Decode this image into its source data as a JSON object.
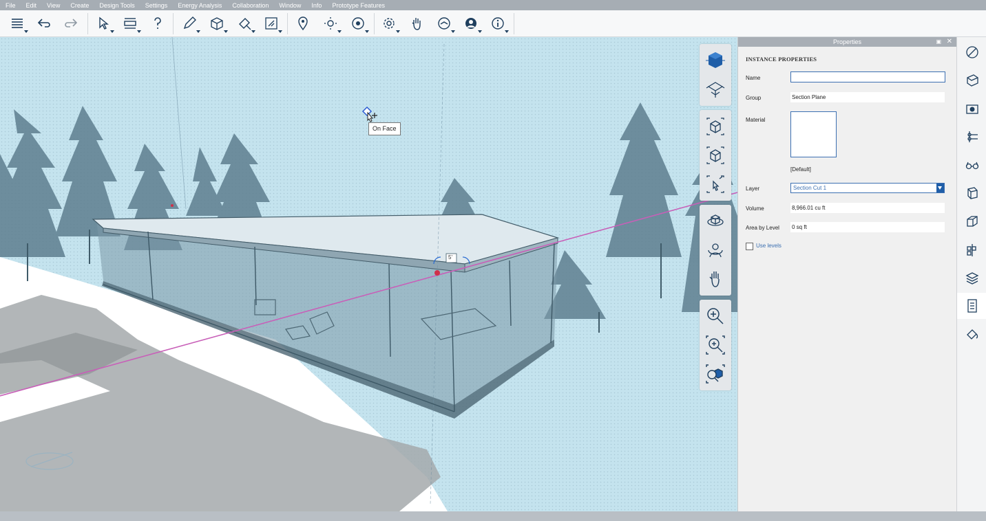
{
  "menu": {
    "items": [
      "File",
      "Edit",
      "View",
      "Create",
      "Design Tools",
      "Settings",
      "Energy Analysis",
      "Collaboration",
      "Window",
      "Info",
      "Prototype Features"
    ]
  },
  "toolbar": {
    "buttons": [
      {
        "icon": "layers-icon"
      },
      {
        "icon": "undo-icon"
      },
      {
        "icon": "redo-icon"
      },
      {
        "icon": "select-icon"
      },
      {
        "icon": "dimension-icon"
      },
      {
        "icon": "help-icon"
      },
      {
        "icon": "draw-icon"
      },
      {
        "icon": "push-pull-icon"
      },
      {
        "icon": "paint-icon"
      },
      {
        "icon": "section-icon"
      },
      {
        "icon": "location-icon"
      },
      {
        "icon": "sun-icon"
      },
      {
        "icon": "view-icon"
      },
      {
        "icon": "settings-icon"
      },
      {
        "icon": "hand-icon"
      },
      {
        "icon": "share-icon"
      },
      {
        "icon": "account-icon"
      },
      {
        "icon": "info-icon"
      }
    ]
  },
  "viewport": {
    "tooltip": "On Face",
    "dimension_label": "5'"
  },
  "properties": {
    "title": "Properties",
    "heading": "INSTANCE PROPERTIES",
    "name_label": "Name",
    "name_value": "",
    "group_label": "Group",
    "group_value": "Section Plane",
    "material_label": "Material",
    "material_value": "[Default]",
    "layer_label": "Layer",
    "layer_value": "Section Cut  1",
    "volume_label": "Volume",
    "volume_value": "8,966.01 cu ft",
    "area_label": "Area by Level",
    "area_value": "0 sq ft",
    "use_levels_label": "Use levels",
    "use_levels_checked": false
  },
  "colors": {
    "accent": "#1f5ea8",
    "sky": "#c4e3ee",
    "building": "#7c99a8",
    "section_line": "#c85fb8"
  }
}
